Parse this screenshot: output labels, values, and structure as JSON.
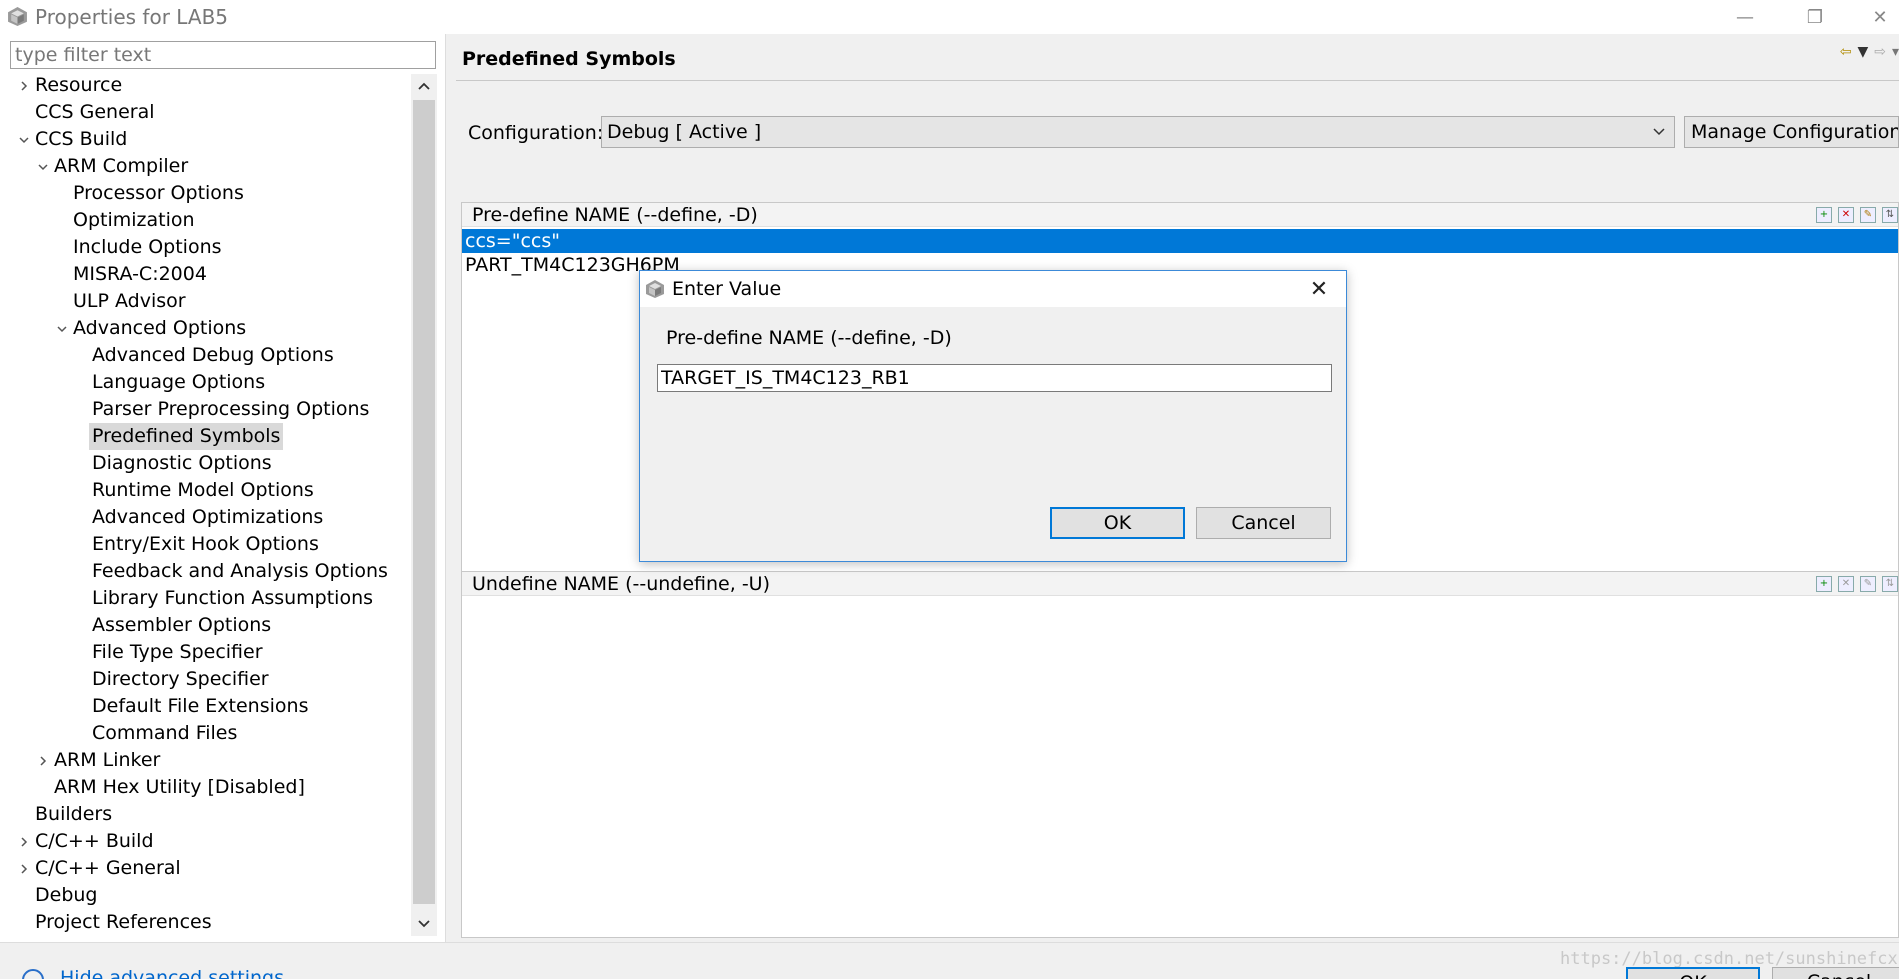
{
  "window": {
    "title": "Properties for LAB5"
  },
  "filter": {
    "placeholder": "type filter text"
  },
  "tree": {
    "resource": "Resource",
    "ccs_general": "CCS General",
    "ccs_build": "CCS Build",
    "arm_compiler": "ARM Compiler",
    "processor_options": "Processor Options",
    "optimization": "Optimization",
    "include_options": "Include Options",
    "misra": "MISRA-C:2004",
    "ulp_advisor": "ULP Advisor",
    "advanced_options": "Advanced Options",
    "advanced_debug_options": "Advanced Debug Options",
    "language_options": "Language Options",
    "parser_preprocessing_options": "Parser Preprocessing Options",
    "predefined_symbols": "Predefined Symbols",
    "diagnostic_options": "Diagnostic Options",
    "runtime_model_options": "Runtime Model Options",
    "advanced_optimizations": "Advanced Optimizations",
    "entry_exit_hook_options": "Entry/Exit Hook Options",
    "feedback_analysis_options": "Feedback and Analysis Options",
    "library_function_assumptions": "Library Function Assumptions",
    "assembler_options": "Assembler Options",
    "file_type_specifier": "File Type Specifier",
    "directory_specifier": "Directory Specifier",
    "default_file_extensions": "Default File Extensions",
    "command_files": "Command Files",
    "arm_linker": "ARM Linker",
    "arm_hex_utility": "ARM Hex Utility  [Disabled]",
    "builders": "Builders",
    "cpp_build": "C/C++ Build",
    "cpp_general": "C/C++ General",
    "debug": "Debug",
    "project_references": "Project References"
  },
  "page": {
    "heading": "Predefined Symbols"
  },
  "config": {
    "label": "Configuration:",
    "value": "Debug  [ Active ]",
    "manage_label": "Manage Configurations..."
  },
  "predefine": {
    "title": "Pre-define NAME (--define, -D)",
    "items": [
      "ccs=\"ccs\"",
      "PART_TM4C123GH6PM"
    ]
  },
  "undefine": {
    "title": "Undefine NAME (--undefine, -U)"
  },
  "dialog": {
    "title": "Enter Value",
    "label": "Pre-define NAME (--define, -D)",
    "value": "TARGET_IS_TM4C123_RB1",
    "ok_label": "OK",
    "cancel_label": "Cancel"
  },
  "bottom": {
    "hide_link": "Hide advanced settings",
    "ok_label": "OK",
    "cancel_label": "Cancel",
    "watermark": "https://blog.csdn.net/sunshinefcx"
  }
}
